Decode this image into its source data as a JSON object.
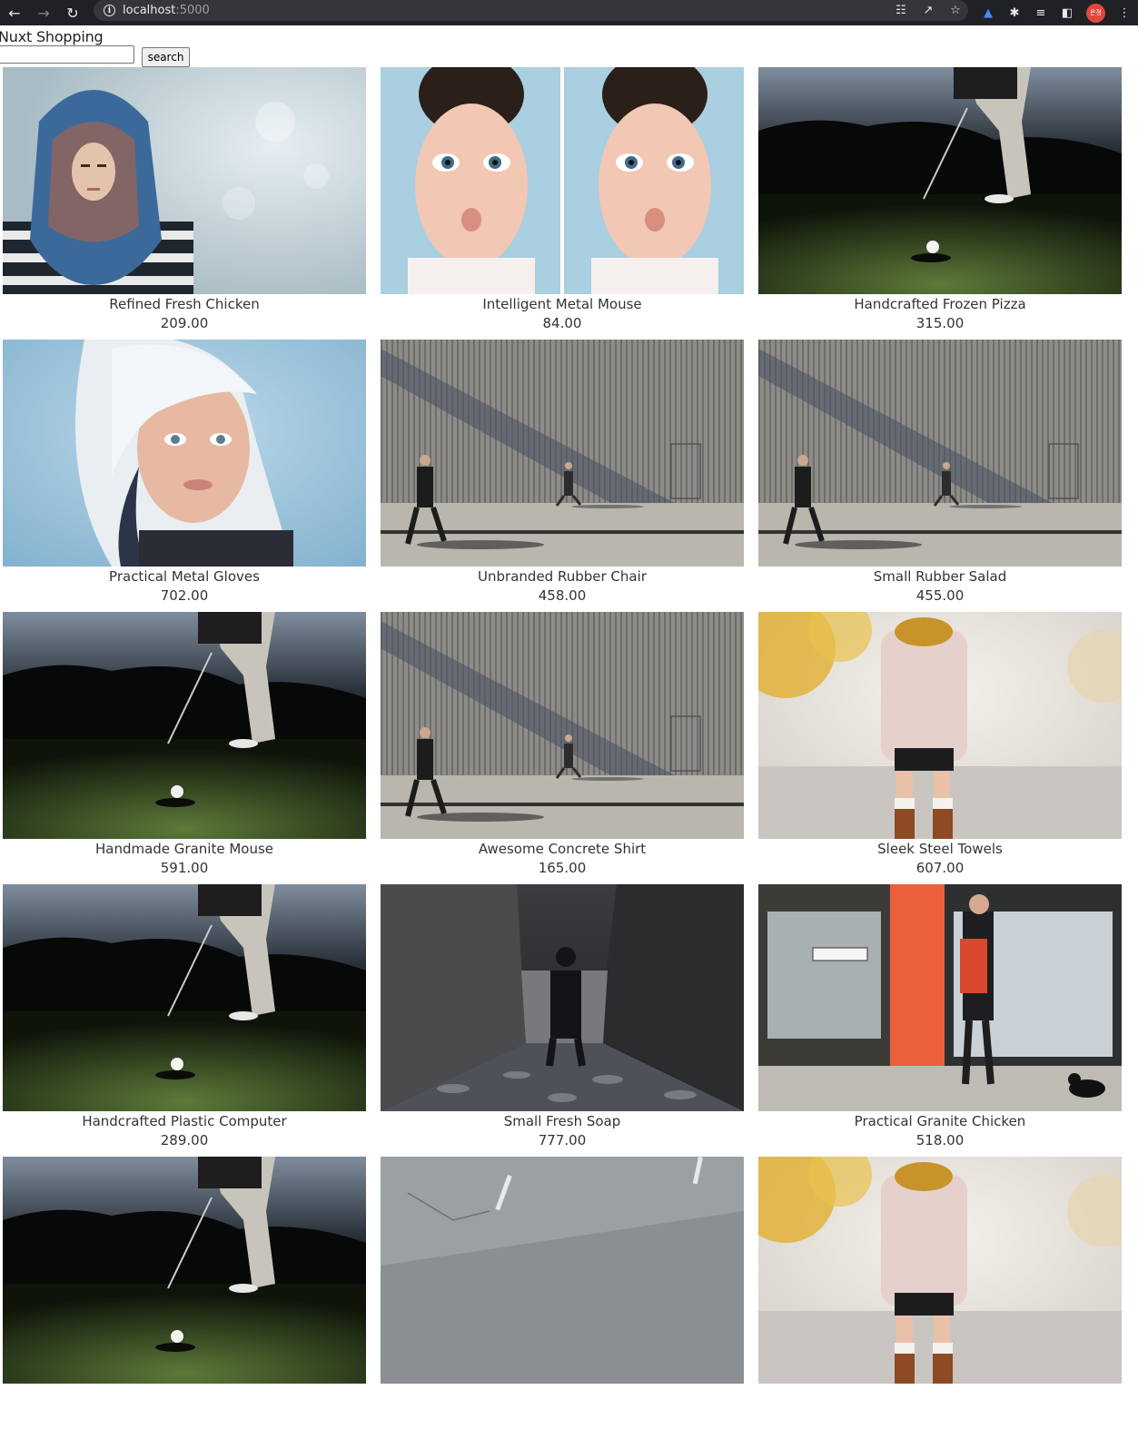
{
  "browser": {
    "url_host": "localhost",
    "url_port": ":5000",
    "avatar_text": "은정"
  },
  "site": {
    "title": "Nuxt Shopping",
    "search_value": "",
    "search_button": "search"
  },
  "products": [
    {
      "name": "Refined Fresh Chicken",
      "price": "209.00",
      "image": "woman-scarf"
    },
    {
      "name": "Intelligent Metal Mouse",
      "price": "84.00",
      "image": "faces"
    },
    {
      "name": "Handcrafted Frozen Pizza",
      "price": "315.00",
      "image": "golf"
    },
    {
      "name": "Practical Metal Gloves",
      "price": "702.00",
      "image": "portrait"
    },
    {
      "name": "Unbranded Rubber Chair",
      "price": "458.00",
      "image": "wall-walkers"
    },
    {
      "name": "Small Rubber Salad",
      "price": "455.00",
      "image": "wall-walkers"
    },
    {
      "name": "Handmade Granite Mouse",
      "price": "591.00",
      "image": "golf"
    },
    {
      "name": "Awesome Concrete Shirt",
      "price": "165.00",
      "image": "wall-walkers"
    },
    {
      "name": "Sleek Steel Towels",
      "price": "607.00",
      "image": "autumn-woman"
    },
    {
      "name": "Handcrafted Plastic Computer",
      "price": "289.00",
      "image": "golf"
    },
    {
      "name": "Small Fresh Soap",
      "price": "777.00",
      "image": "tunnel"
    },
    {
      "name": "Practical Granite Chicken",
      "price": "518.00",
      "image": "shop-street"
    },
    {
      "name": "",
      "price": "",
      "image": "golf"
    },
    {
      "name": "",
      "price": "",
      "image": "road"
    },
    {
      "name": "",
      "price": "",
      "image": "autumn-woman"
    }
  ]
}
